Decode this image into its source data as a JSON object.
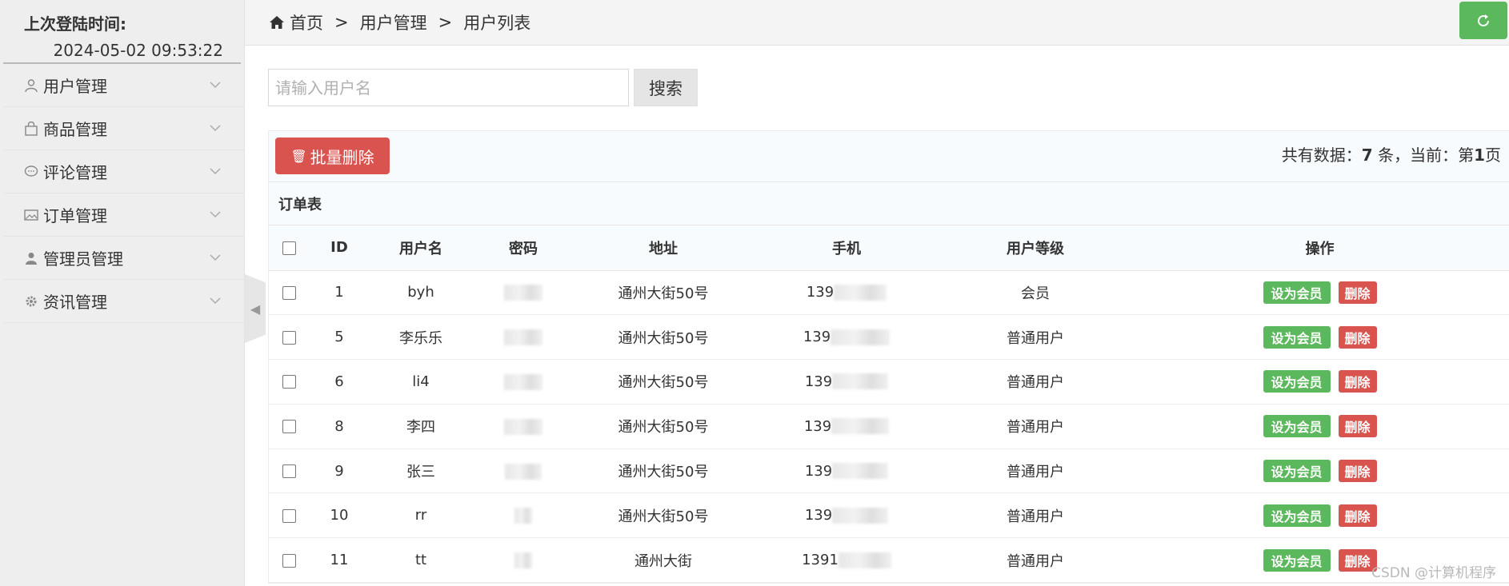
{
  "sidebar": {
    "login_title": "上次登陆时间:",
    "login_time": "2024-05-02 09:53:22",
    "items": [
      {
        "label": "用户管理",
        "icon": "user-icon"
      },
      {
        "label": "商品管理",
        "icon": "bag-icon"
      },
      {
        "label": "评论管理",
        "icon": "comment-icon"
      },
      {
        "label": "订单管理",
        "icon": "image-icon"
      },
      {
        "label": "管理员管理",
        "icon": "admin-icon"
      },
      {
        "label": "资讯管理",
        "icon": "gear-icon"
      }
    ]
  },
  "breadcrumb": {
    "home": "首页",
    "sep1": ">",
    "section": "用户管理",
    "sep2": ">",
    "page": "用户列表"
  },
  "search": {
    "placeholder": "请输入用户名",
    "value": "",
    "button": "搜索"
  },
  "toolbar": {
    "batch_delete": "批量删除",
    "count_prefix": "共有数据：",
    "count": "7",
    "count_mid": " 条，当前：第",
    "page": "1",
    "count_suffix": "页"
  },
  "table": {
    "caption": "订单表",
    "headers": [
      "ID",
      "用户名",
      "密码",
      "地址",
      "手机",
      "用户等级",
      "操作"
    ],
    "rows": [
      {
        "id": "1",
        "username": "byh",
        "address": "通州大街50号",
        "phone_prefix": "139",
        "level": "会员"
      },
      {
        "id": "5",
        "username": "李乐乐",
        "address": "通州大街50号",
        "phone_prefix": "139",
        "level": "普通用户"
      },
      {
        "id": "6",
        "username": "li4",
        "address": "通州大街50号",
        "phone_prefix": "139",
        "level": "普通用户"
      },
      {
        "id": "8",
        "username": "李四",
        "address": "通州大街50号",
        "phone_prefix": "139",
        "level": "普通用户"
      },
      {
        "id": "9",
        "username": "张三",
        "address": "通州大街50号",
        "phone_prefix": "139",
        "level": "普通用户"
      },
      {
        "id": "10",
        "username": "rr",
        "address": "通州大街50号",
        "phone_prefix": "139",
        "level": "普通用户"
      },
      {
        "id": "11",
        "username": "tt",
        "address": "通州大街",
        "phone_prefix": "1391",
        "level": "普通用户"
      }
    ],
    "set_member": "设为会员",
    "delete": "删除"
  },
  "watermark": "CSDN @计算机程序",
  "colors": {
    "green": "#5cb85c",
    "red": "#d9534f",
    "sidebar_bg": "#eeeeee"
  }
}
